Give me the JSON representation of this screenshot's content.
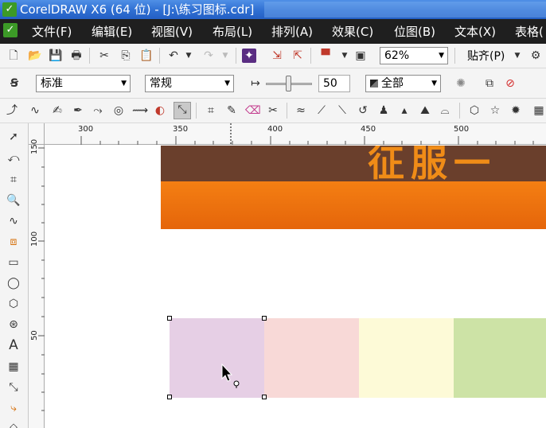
{
  "window": {
    "title": "CorelDRAW X6 (64 位) - [J:\\练习图标.cdr]"
  },
  "menu": [
    "文件(F)",
    "编辑(E)",
    "视图(V)",
    "布局(L)",
    "排列(A)",
    "效果(C)",
    "位图(B)",
    "文本(X)",
    "表格("
  ],
  "toolbar1": {
    "zoom_value": "62%",
    "snap_label": "贴齐(P)"
  },
  "toolbar2": {
    "style_select": "标准",
    "outline_select": "常规",
    "value_field": "50",
    "all_select": "全部"
  },
  "ruler": {
    "h_ticks": [
      "300",
      "350",
      "400",
      "450",
      "500"
    ],
    "v_ticks": [
      "150",
      "100",
      "50"
    ]
  },
  "canvas": {
    "banner_text": "征服一"
  },
  "colors": {
    "swatch1": "#e6cfe5",
    "swatch2": "#f8d9d7",
    "swatch3": "#fdfad7",
    "swatch4": "#cde3a6",
    "banner_dark": "#6a3f2c",
    "banner_orange": "#f07a12"
  },
  "icons": {
    "toolbar1": [
      "new-doc-icon",
      "open-icon",
      "save-icon",
      "print-icon",
      "cut-icon",
      "copy-icon",
      "paste-icon",
      "undo-icon",
      "redo-icon",
      "import-icon",
      "export-icon",
      "publish-icon",
      "app-launcher-icon",
      "options-icon"
    ],
    "tools": [
      "pick-tool-icon",
      "shape-tool-icon",
      "crop-tool-icon",
      "zoom-tool-icon",
      "freehand-tool-icon",
      "smart-fill-icon",
      "rectangle-tool-icon",
      "ellipse-tool-icon",
      "polygon-tool-icon",
      "basic-shapes-icon",
      "text-tool-icon",
      "table-tool-icon",
      "dimension-tool-icon",
      "connector-tool-icon",
      "interactive-fill-icon"
    ]
  }
}
